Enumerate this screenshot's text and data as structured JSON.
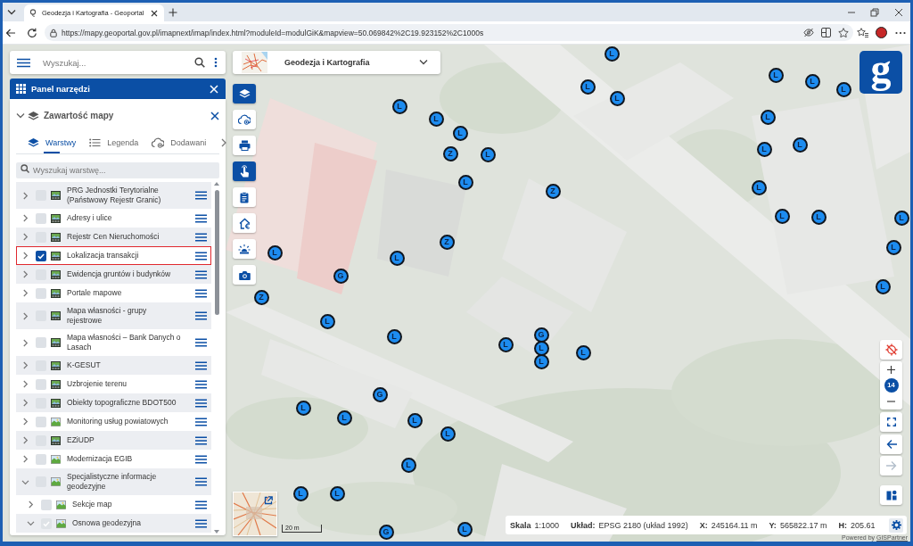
{
  "browser": {
    "tab_title": "Geodezja i Kartografia - Geoportal",
    "url": "https://mapy.geoportal.gov.pl/imapnext/imap/index.html?moduleId=modulGiK&mapview=50.069842%2C19.923152%2C1000s"
  },
  "search": {
    "placeholder": "Wyszukaj..."
  },
  "tool_panel": {
    "title": "Panel narzędzi"
  },
  "map_contents": {
    "title": "Zawartość mapy",
    "expanded": true,
    "tabs": [
      {
        "kind": "layers",
        "label": "Warstwy",
        "selected": true
      },
      {
        "kind": "legend",
        "label": "Legenda",
        "selected": false
      },
      {
        "kind": "add",
        "label": "Dodawani",
        "selected": false
      }
    ],
    "layer_search": {
      "placeholder": "Wyszukaj warstwę..."
    },
    "layers": [
      {
        "name": "PRG Jednostki Terytorialne (Państwowy Rejestr Granic)",
        "kind": "service",
        "expanded": false,
        "checked": false,
        "disabled": false,
        "highlighted": false
      },
      {
        "name": "Adresy i ulice",
        "kind": "service",
        "expanded": false,
        "checked": false,
        "disabled": false,
        "highlighted": false
      },
      {
        "name": "Rejestr Cen Nieruchomości",
        "kind": "service",
        "expanded": false,
        "checked": false,
        "disabled": false,
        "highlighted": false
      },
      {
        "name": "Lokalizacja transakcji",
        "kind": "service",
        "expanded": false,
        "checked": true,
        "disabled": false,
        "highlighted": true
      },
      {
        "name": "Ewidencja gruntów i budynków",
        "kind": "service",
        "expanded": false,
        "checked": false,
        "disabled": false,
        "highlighted": false
      },
      {
        "name": "Portale mapowe",
        "kind": "service",
        "expanded": false,
        "checked": false,
        "disabled": false,
        "highlighted": false
      },
      {
        "name": "Mapa własności - grupy rejestrowe",
        "kind": "service",
        "expanded": false,
        "checked": false,
        "disabled": false,
        "highlighted": false
      },
      {
        "name": "Mapa własności – Bank Danych o Lasach",
        "kind": "service",
        "expanded": false,
        "checked": false,
        "disabled": false,
        "highlighted": false
      },
      {
        "name": "K-GESUT",
        "kind": "service",
        "expanded": false,
        "checked": false,
        "disabled": false,
        "highlighted": false
      },
      {
        "name": "Uzbrojenie terenu",
        "kind": "service",
        "expanded": false,
        "checked": false,
        "disabled": false,
        "highlighted": false
      },
      {
        "name": "Obiekty topograficzne BDOT500",
        "kind": "service",
        "expanded": false,
        "checked": false,
        "disabled": false,
        "highlighted": false
      },
      {
        "name": "Monitoring usług powiatowych",
        "kind": "image",
        "expanded": false,
        "checked": false,
        "disabled": false,
        "highlighted": false
      },
      {
        "name": "EZiUDP",
        "kind": "service",
        "expanded": false,
        "checked": false,
        "disabled": false,
        "highlighted": false
      },
      {
        "name": "Modernizacja EGIB",
        "kind": "image",
        "expanded": false,
        "checked": false,
        "disabled": false,
        "highlighted": false
      },
      {
        "name": "Specjalistyczne informacje geodezyjne",
        "kind": "image",
        "expanded": true,
        "checked": false,
        "disabled": false,
        "highlighted": false,
        "children": [
          {
            "name": "Sekcje map",
            "kind": "image",
            "expanded": false,
            "checked": false,
            "disabled": false,
            "highlighted": false
          },
          {
            "name": "Osnowa geodezyjna",
            "kind": "image",
            "expanded": true,
            "checked": true,
            "disabled": true,
            "highlighted": false
          }
        ]
      }
    ]
  },
  "module": {
    "title": "Geodezja i Kartografia"
  },
  "toolbar": [
    {
      "kind": "layers",
      "active": true
    },
    {
      "kind": "cloud",
      "active": false
    },
    {
      "kind": "print",
      "active": false
    },
    {
      "kind": "touch",
      "active": true
    },
    {
      "kind": "clipboard",
      "active": false
    },
    {
      "kind": "house",
      "active": false
    },
    {
      "kind": "beacon",
      "active": false
    },
    {
      "kind": "camera",
      "active": false
    }
  ],
  "logo": {
    "text": "g"
  },
  "map_controls": {
    "zoom": "14",
    "history": [
      {
        "kind": "back",
        "disabled": false
      },
      {
        "kind": "forward",
        "disabled": true
      }
    ]
  },
  "markers": [
    {
      "label": "L"
    },
    {
      "label": "L"
    },
    {
      "label": "L"
    },
    {
      "label": "L"
    },
    {
      "label": "L"
    },
    {
      "label": "L"
    },
    {
      "label": "L"
    },
    {
      "label": "L"
    },
    {
      "label": "L"
    },
    {
      "label": "L"
    },
    {
      "label": "L"
    },
    {
      "label": "L"
    },
    {
      "label": "Z"
    },
    {
      "label": "L"
    },
    {
      "label": "L"
    },
    {
      "label": "Z"
    },
    {
      "label": "L"
    },
    {
      "label": "L"
    },
    {
      "label": "L"
    },
    {
      "label": "L"
    },
    {
      "label": "Z"
    },
    {
      "label": "L"
    },
    {
      "label": "L"
    },
    {
      "label": "L"
    },
    {
      "label": "G"
    },
    {
      "label": "L"
    },
    {
      "label": "Z"
    },
    {
      "label": "L"
    },
    {
      "label": "L"
    },
    {
      "label": "L"
    },
    {
      "label": "G"
    },
    {
      "label": "L"
    },
    {
      "label": "L"
    },
    {
      "label": "L"
    },
    {
      "label": "G"
    },
    {
      "label": "L"
    },
    {
      "label": "L"
    },
    {
      "label": "L"
    },
    {
      "label": "L"
    },
    {
      "label": "L"
    },
    {
      "label": "L"
    },
    {
      "label": "L"
    },
    {
      "label": "L"
    },
    {
      "label": "G"
    }
  ],
  "scale_bar": "20 m",
  "status_bar": [
    {
      "label": "Skala",
      "value": "1:1000"
    },
    {
      "label": "Układ:",
      "value": "EPSG 2180 (układ 1992)"
    },
    {
      "label": "X:",
      "value": "245164.11 m"
    },
    {
      "label": "Y:",
      "value": "565822.17 m"
    },
    {
      "label": "H:",
      "value": "205.61"
    }
  ],
  "attribution": {
    "text": "Powered by",
    "link": "GISPartner"
  }
}
